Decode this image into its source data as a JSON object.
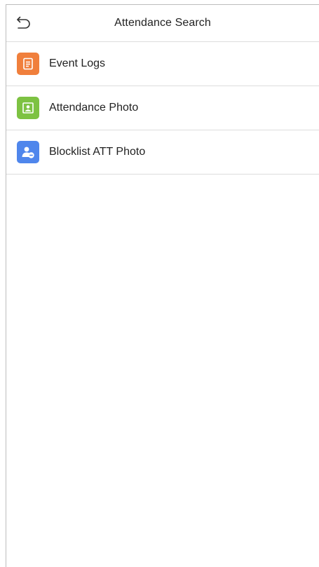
{
  "header": {
    "title": "Attendance Search",
    "back_icon": "back-arrow-icon"
  },
  "menu": {
    "items": [
      {
        "label": "Event Logs",
        "icon": "event-logs-icon",
        "color": "#F07F3C"
      },
      {
        "label": "Attendance Photo",
        "icon": "attendance-photo-icon",
        "color": "#7DC242"
      },
      {
        "label": "Blocklist ATT Photo",
        "icon": "blocklist-photo-icon",
        "color": "#4F86EC"
      }
    ]
  }
}
